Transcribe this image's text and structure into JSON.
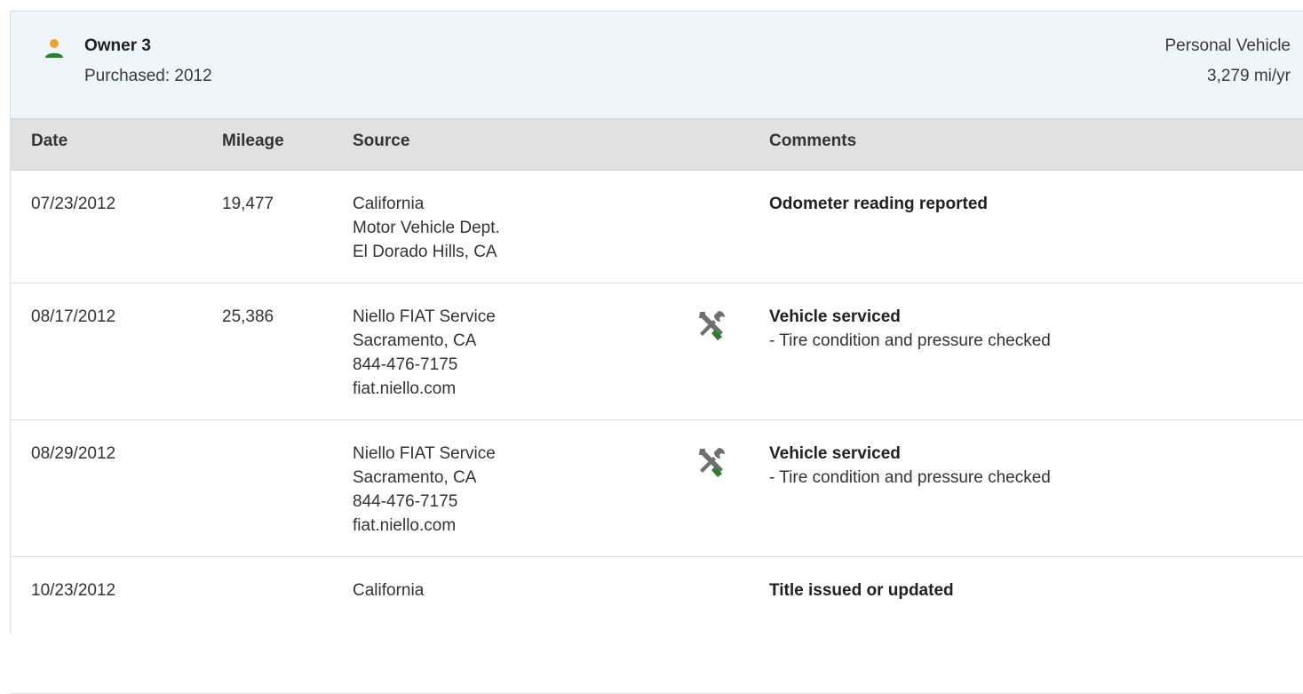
{
  "owner": {
    "name": "Owner 3",
    "purchased": "Purchased: 2012",
    "vehicle_type": "Personal Vehicle",
    "mileage_rate": "3,279 mi/yr",
    "icon": "person-icon",
    "icon_color": "#2e7d32",
    "icon_head_color": "#f0a32c"
  },
  "table": {
    "headers": {
      "date": "Date",
      "mileage": "Mileage",
      "source": "Source",
      "comments": "Comments"
    },
    "rows": [
      {
        "date": "07/23/2012",
        "mileage": "19,477",
        "source": [
          "California",
          "Motor Vehicle Dept.",
          "El Dorado Hills, CA"
        ],
        "icon": "",
        "comment_title": "Odometer reading reported",
        "comment_details": []
      },
      {
        "date": "08/17/2012",
        "mileage": "25,386",
        "source": [
          "Niello FIAT Service",
          "Sacramento, CA",
          "844-476-7175",
          "fiat.niello.com"
        ],
        "icon": "service-tools-icon",
        "comment_title": "Vehicle serviced",
        "comment_details": [
          "- Tire condition and pressure checked"
        ]
      },
      {
        "date": "08/29/2012",
        "mileage": "",
        "source": [
          "Niello FIAT Service",
          "Sacramento, CA",
          "844-476-7175",
          "fiat.niello.com"
        ],
        "icon": "service-tools-icon",
        "comment_title": "Vehicle serviced",
        "comment_details": [
          "- Tire condition and pressure checked"
        ]
      },
      {
        "date": "10/23/2012",
        "mileage": "",
        "source": [
          "California"
        ],
        "icon": "",
        "comment_title": "Title issued or updated",
        "comment_details": []
      }
    ]
  },
  "colors": {
    "header_bg": "#eef5fb",
    "table_head_bg": "#e1e1e1",
    "tool_gray": "#6f6f6f",
    "tool_green": "#2e7d32"
  }
}
